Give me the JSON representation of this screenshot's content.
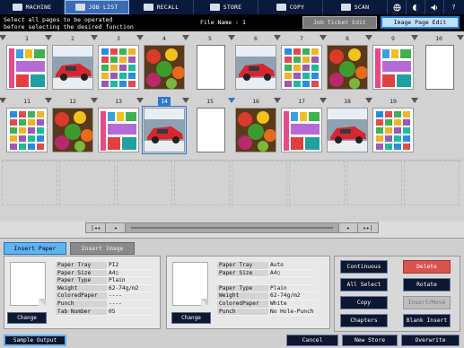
{
  "topbar": {
    "tabs": [
      {
        "label": "MACHINE",
        "icon": "machine-icon",
        "active": false
      },
      {
        "label": "JOB LIST",
        "icon": "job-list-icon",
        "active": true
      },
      {
        "label": "RECALL",
        "icon": "recall-icon",
        "active": false
      },
      {
        "label": "STORE",
        "icon": "store-icon",
        "active": false
      },
      {
        "label": "COPY",
        "icon": "copy-icon",
        "active": false
      },
      {
        "label": "SCAN",
        "icon": "scan-icon",
        "active": false
      }
    ],
    "icons": [
      "globe-icon",
      "brightness-icon",
      "volume-icon",
      "help-icon"
    ],
    "help_glyph": "?"
  },
  "message": {
    "line1": "Select all pages to be operated",
    "line2": "before selecting the desired function",
    "file_name": "File Name : 1"
  },
  "mode_buttons": {
    "job_ticket_edit": "Job Ticket Edit",
    "image_page_edit": "Image Page Edit"
  },
  "pages": {
    "row1": [
      "1",
      "2",
      "3",
      "4",
      "5",
      "6",
      "7",
      "8",
      "9",
      "10"
    ],
    "row2": [
      "11",
      "12",
      "13",
      "14",
      "15",
      "16",
      "17",
      "18",
      "19"
    ],
    "selected": "14",
    "blank_pages": [
      "5",
      "10",
      "15"
    ]
  },
  "scrollbar": {
    "first": "|◂◂",
    "prev": "◂",
    "next": "▸",
    "last": "▸▸|"
  },
  "insert_tabs": {
    "insert_paper": "Insert Paper",
    "insert_image": "Insert Image"
  },
  "left_paper": {
    "change_label": "Change",
    "rows": [
      {
        "k": "Paper Tray",
        "v": "PI2"
      },
      {
        "k": "Paper Size",
        "v": "A4▯"
      },
      {
        "k": "Paper Type",
        "v": "Plain"
      },
      {
        "k": "Weight",
        "v": "62-74g/m2"
      },
      {
        "k": "ColoredPaper",
        "v": "----"
      },
      {
        "k": "Punch",
        "v": "----"
      },
      {
        "k": "Tab Number",
        "v": "05"
      }
    ]
  },
  "right_paper": {
    "change_label": "Change",
    "rows": [
      {
        "k": "Paper Tray",
        "v": "Auto"
      },
      {
        "k": "Paper Size",
        "v": "A4▯"
      },
      {
        "k": "",
        "v": ""
      },
      {
        "k": "Paper Type",
        "v": "Plain"
      },
      {
        "k": "Weight",
        "v": "62-74g/m2"
      },
      {
        "k": "ColoredPaper",
        "v": "White"
      },
      {
        "k": "Punch",
        "v": "No Hole-Punch"
      }
    ]
  },
  "actions": {
    "continuous": "Continuous",
    "delete": "Delete",
    "all_select": "All Select",
    "rotate": "Rotate",
    "copy": "Copy",
    "insert_move": "Insert/Move",
    "chapters": "Chapters",
    "blank_insert": "Blank Insert"
  },
  "footer": {
    "sample_output": "Sample Output",
    "cancel": "Cancel",
    "new_store": "New Store",
    "overwrite": "Overwrite"
  }
}
